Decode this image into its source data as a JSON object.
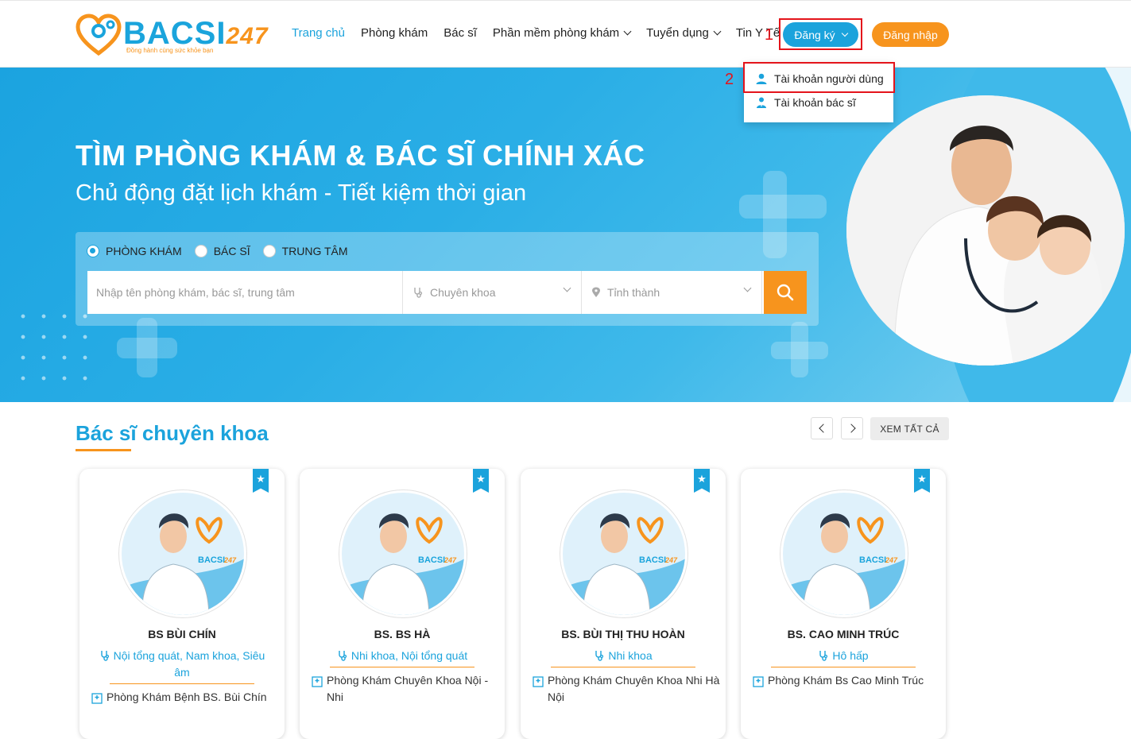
{
  "header": {
    "logo_text": "BACSI",
    "logo_num": "247",
    "logo_slogan": "Đồng hành cùng sức khỏe bạn",
    "nav": [
      {
        "label": "Trang chủ",
        "active": true,
        "dropdown": false
      },
      {
        "label": "Phòng khám",
        "active": false,
        "dropdown": false
      },
      {
        "label": "Bác sĩ",
        "active": false,
        "dropdown": false
      },
      {
        "label": "Phần mềm phòng khám",
        "active": false,
        "dropdown": true
      },
      {
        "label": "Tuyển dụng",
        "active": false,
        "dropdown": true
      },
      {
        "label": "Tin Y Tế",
        "active": false,
        "dropdown": false
      }
    ],
    "register_label": "Đăng ký",
    "login_label": "Đăng nhập"
  },
  "annotations": {
    "step1": "1",
    "step2": "2",
    "color": "#e4141b"
  },
  "dropdown": {
    "items": [
      {
        "label": "Tài khoản người dùng",
        "icon": "user-icon"
      },
      {
        "label": "Tài khoản bác sĩ",
        "icon": "doctor-icon"
      }
    ]
  },
  "hero": {
    "title": "TÌM PHÒNG KHÁM & BÁC SĨ CHÍNH XÁC",
    "subtitle": "Chủ động đặt lịch khám - Tiết kiệm thời gian",
    "radios": [
      {
        "label": "PHÒNG KHÁM",
        "checked": true
      },
      {
        "label": "BÁC SĨ",
        "checked": false
      },
      {
        "label": "TRUNG TÂM",
        "checked": false
      }
    ],
    "search_placeholder": "Nhập tên phòng khám, bác sĩ, trung tâm",
    "specialty_placeholder": "Chuyên khoa",
    "province_placeholder": "Tỉnh thành"
  },
  "section": {
    "title": "Bác sĩ chuyên khoa",
    "view_all": "XEM TẤT CẢ"
  },
  "doctors": [
    {
      "name": "BS BÙI CHÍN",
      "specialty": "Nội tổng quát, Nam khoa, Siêu âm",
      "clinic": "Phòng Khám Bệnh BS. Bùi Chín"
    },
    {
      "name": "BS. BS HÀ",
      "specialty": "Nhi khoa, Nội tổng quát",
      "clinic": "Phòng Khám Chuyên Khoa Nội - Nhi"
    },
    {
      "name": "BS. BÙI THỊ THU HOÀN",
      "specialty": "Nhi khoa",
      "clinic": "Phòng Khám Chuyên Khoa Nhi Hà Nội"
    },
    {
      "name": "BS. CAO MINH TRÚC",
      "specialty": "Hô hấp",
      "clinic": "Phòng Khám Bs Cao Minh Trúc"
    }
  ],
  "colors": {
    "brand_blue": "#1ba3dc",
    "brand_orange": "#f7941d",
    "annotation_red": "#e4141b"
  }
}
